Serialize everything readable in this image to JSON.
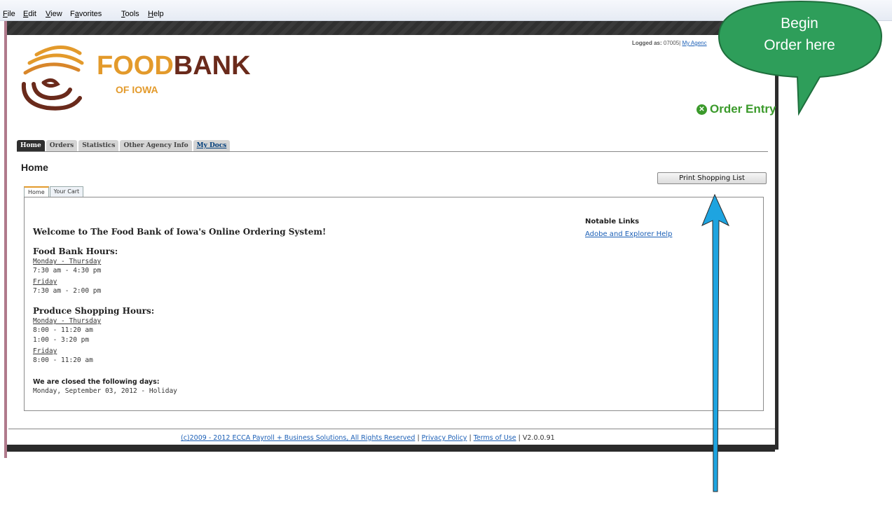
{
  "menu": {
    "items": [
      {
        "label_u": "F",
        "label_rest": "ile"
      },
      {
        "label_u": "E",
        "label_rest": "dit"
      },
      {
        "label_u": "V",
        "label_rest": "iew"
      },
      {
        "label_pre": "F",
        "label_u": "a",
        "label_rest": "vorites"
      },
      {
        "label_u": "T",
        "label_rest": "ools"
      },
      {
        "label_u": "H",
        "label_rest": "elp"
      }
    ]
  },
  "brand": {
    "name_part1": "FOOD",
    "name_part2": "BANK",
    "subtitle": "OF IOWA",
    "colors": {
      "orange": "#e39a2b",
      "brown": "#6a2a1b"
    }
  },
  "header": {
    "logged_label": "Logged as:",
    "logged_user": "07005|",
    "agency_link": "My Agenc",
    "order_entry": "Order Entry"
  },
  "nav": {
    "tabs": [
      "Home",
      "Orders",
      "Statistics",
      "Other Agency Info",
      "My Docs"
    ],
    "active": "Home"
  },
  "page": {
    "title": "Home",
    "print_button": "Print Shopping List",
    "subtabs": [
      "Home",
      "Your Cart"
    ]
  },
  "content": {
    "welcome": "Welcome to The Food Bank of Iowa's Online Ordering System!",
    "food_bank_hours": {
      "heading": "Food Bank Hours:",
      "lines": [
        "Monday - Thursday",
        "7:30 am - 4:30 pm",
        "Friday",
        "7:30 am - 2:00 pm"
      ]
    },
    "produce_hours": {
      "heading": "Produce Shopping Hours:",
      "lines": [
        "Monday - Thursday",
        "8:00 - 11:20 am",
        "1:00 - 3:20 pm",
        "Friday",
        "8:00 - 11:20 am"
      ]
    },
    "closed": {
      "heading": "We are closed the following days:",
      "line": "Monday, September 03, 2012 - Holiday"
    },
    "notable": {
      "heading": "Notable Links",
      "link": "Adobe and Explorer Help"
    }
  },
  "footer": {
    "copyright": "(c)2009 - 2012 ECCA Payroll + Business Solutions, All Rights Reserved",
    "sep": "|",
    "privacy": "Privacy Policy",
    "terms": "Terms of Use",
    "version": "V2.0.0.91"
  },
  "annotation": {
    "callout_line1": "Begin",
    "callout_line2": "Order here",
    "callout_color": "#2e9e5a",
    "arrow_color": "#1ea4e0"
  }
}
